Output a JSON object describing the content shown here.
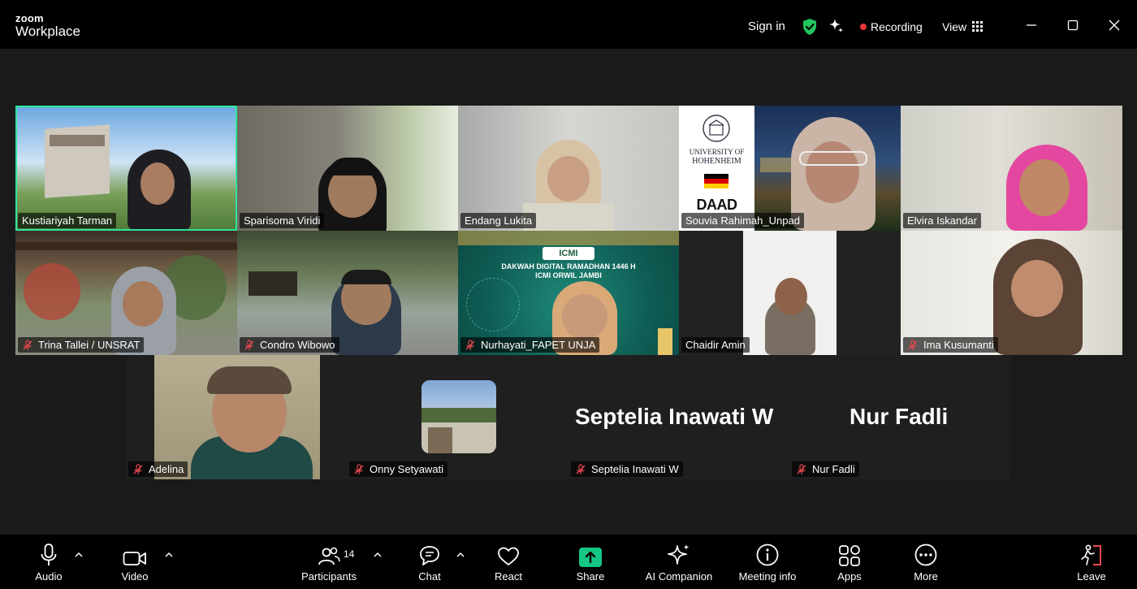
{
  "app": {
    "brand_top": "zoom",
    "brand_bottom": "Workplace",
    "sign_in": "Sign in",
    "recording": "Recording",
    "view": "View"
  },
  "participants": [
    {
      "name": "Kustiariyah Tarman",
      "muted": false,
      "active": true
    },
    {
      "name": "Sparisoma Viridi",
      "muted": false
    },
    {
      "name": "Endang Lukita",
      "muted": false
    },
    {
      "name": "Souvia Rahimah_Unpad",
      "muted": false
    },
    {
      "name": "Elvira Iskandar",
      "muted": false
    },
    {
      "name": "Trina Tallei / UNSRAT",
      "muted": true
    },
    {
      "name": "Condro Wibowo",
      "muted": true
    },
    {
      "name": "Nurhayati_FAPET UNJA",
      "muted": true
    },
    {
      "name": "Chaidir Amin",
      "muted": false
    },
    {
      "name": "Ima Kusumanti",
      "muted": true
    },
    {
      "name": "Adelina",
      "muted": true
    },
    {
      "name": "Onny Setyawati",
      "muted": true
    },
    {
      "name": "Septelia Inawati W",
      "muted": true
    },
    {
      "name": "Nur Fadli",
      "muted": true
    }
  ],
  "backgrounds": {
    "uni_line1": "UNIVERSITY OF",
    "uni_line2": "HOHENHEIM",
    "daad": "DAAD",
    "icmi_logo": "ICMI",
    "banner_line1": "DAKWAH DIGITAL RAMADHAN 1446 H",
    "banner_line2": "ICMI ORWIL JAMBI"
  },
  "toolbar": {
    "audio": "Audio",
    "video": "Video",
    "participants": "Participants",
    "participants_count": "14",
    "chat": "Chat",
    "react": "React",
    "share": "Share",
    "ai_companion": "AI Companion",
    "meeting_info": "Meeting info",
    "apps": "Apps",
    "more": "More",
    "leave": "Leave"
  },
  "colors": {
    "active_speaker": "#2ee59d",
    "recording_dot": "#e8353b",
    "shield": "#22c55e",
    "share": "#16c784",
    "leave": "#e5484d"
  }
}
